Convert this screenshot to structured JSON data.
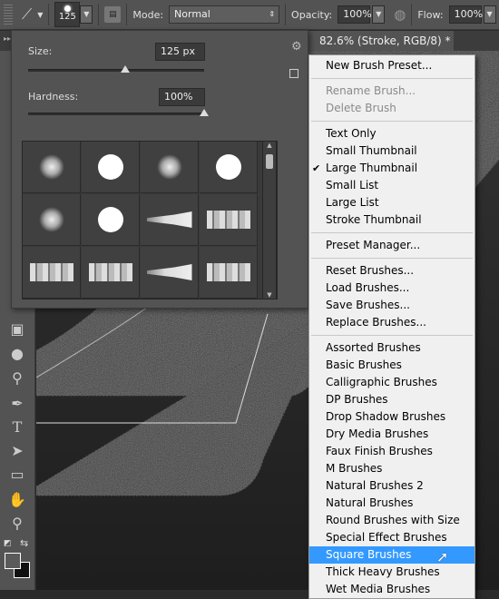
{
  "options_bar": {
    "brush_size": "125",
    "mode_label": "Mode:",
    "mode_value": "Normal",
    "opacity_label": "Opacity:",
    "opacity_value": "100%",
    "flow_label": "Flow:",
    "flow_value": "100%"
  },
  "document_tab": {
    "title": "82.6% (Stroke, RGB/8) *",
    "close": "×"
  },
  "brush_panel": {
    "size_label": "Size:",
    "size_value": "125 px",
    "size_fraction": 0.55,
    "hardness_label": "Hardness:",
    "hardness_value": "100%",
    "hardness_fraction": 1.0,
    "brushes": [
      "soft-round",
      "hard-round",
      "soft-round",
      "hard-round",
      "soft-round",
      "hard-round",
      "fan-brush",
      "flat-brush",
      "flat-brush",
      "flat-brush",
      "fan-brush",
      "flat-brush"
    ]
  },
  "menu": {
    "groups": [
      [
        {
          "label": "New Brush Preset..."
        }
      ],
      [
        {
          "label": "Rename Brush...",
          "disabled": true
        },
        {
          "label": "Delete Brush",
          "disabled": true
        }
      ],
      [
        {
          "label": "Text Only"
        },
        {
          "label": "Small Thumbnail"
        },
        {
          "label": "Large Thumbnail",
          "checked": true
        },
        {
          "label": "Small List"
        },
        {
          "label": "Large List"
        },
        {
          "label": "Stroke Thumbnail"
        }
      ],
      [
        {
          "label": "Preset Manager..."
        }
      ],
      [
        {
          "label": "Reset Brushes..."
        },
        {
          "label": "Load Brushes..."
        },
        {
          "label": "Save Brushes..."
        },
        {
          "label": "Replace Brushes..."
        }
      ],
      [
        {
          "label": "Assorted Brushes"
        },
        {
          "label": "Basic Brushes"
        },
        {
          "label": "Calligraphic Brushes"
        },
        {
          "label": "DP Brushes"
        },
        {
          "label": "Drop Shadow Brushes"
        },
        {
          "label": "Dry Media Brushes"
        },
        {
          "label": "Faux Finish Brushes"
        },
        {
          "label": "M Brushes"
        },
        {
          "label": "Natural Brushes 2"
        },
        {
          "label": "Natural Brushes"
        },
        {
          "label": "Round Brushes with Size"
        },
        {
          "label": "Special Effect Brushes"
        },
        {
          "label": "Square Brushes",
          "highlighted": true
        },
        {
          "label": "Thick Heavy Brushes"
        },
        {
          "label": "Wet Media Brushes"
        }
      ]
    ]
  },
  "colors": {
    "highlight": "#3399ff",
    "panel": "#535353",
    "menu": "#f0f0f0"
  }
}
